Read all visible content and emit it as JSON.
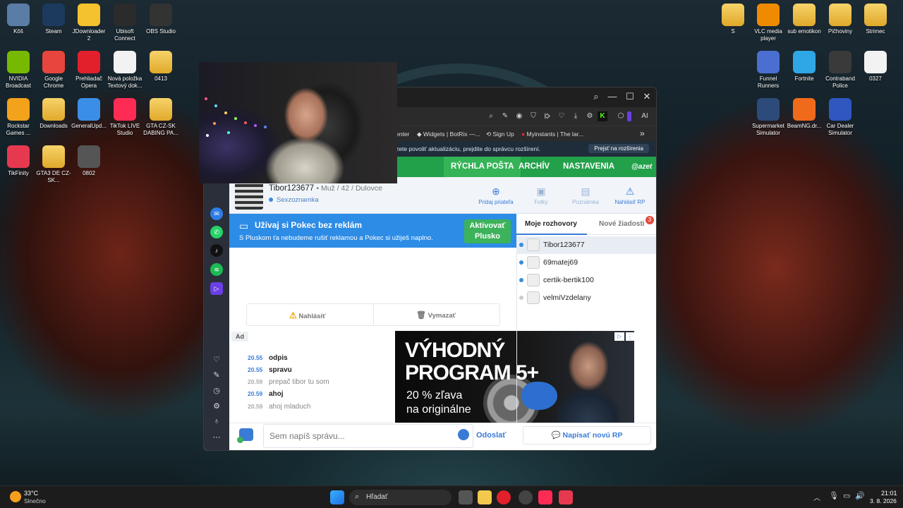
{
  "desktop": {
    "left_icons": [
      {
        "label": "Kôš",
        "icon": "recycle-bin-icon",
        "color": "#5a7da6"
      },
      {
        "label": "Steam",
        "icon": "steam-icon",
        "color": "#1b3a5e"
      },
      {
        "label": "JDownloader 2",
        "icon": "jdownloader-icon",
        "color": "#f3c22e"
      },
      {
        "label": "Ubisoft Connect",
        "icon": "ubisoft-icon",
        "color": "#2b2b2b"
      },
      {
        "label": "OBS Studio",
        "icon": "obs-icon",
        "color": "#333333"
      },
      {
        "label": "NVIDIA Broadcast",
        "icon": "nvidia-icon",
        "color": "#76b900"
      },
      {
        "label": "Google Chrome",
        "icon": "chrome-icon",
        "color": "#e8453c"
      },
      {
        "label": "Prehliadač Opera",
        "icon": "opera-icon",
        "color": "#e2202c"
      },
      {
        "label": "Nová položka Textový dok...",
        "icon": "text-document-icon",
        "color": "#f2f2f2"
      },
      {
        "label": "0413",
        "icon": "folder-icon",
        "color": "#f2c94c"
      },
      {
        "label": "Rockstar Games ...",
        "icon": "rockstar-icon",
        "color": "#f3a21c"
      },
      {
        "label": "Downloads",
        "icon": "folder-icon",
        "color": "#f2c94c"
      },
      {
        "label": "GeneralUpd...",
        "icon": "shield-icon",
        "color": "#3a8ee6"
      },
      {
        "label": "TikTok LIVE Studio",
        "icon": "tiktok-icon",
        "color": "#fe2c55"
      },
      {
        "label": "GTA CZ-SK DABING PA...",
        "icon": "folder-icon",
        "color": "#f2c94c"
      },
      {
        "label": "TikFinity",
        "icon": "tikfinity-icon",
        "color": "#e63950"
      },
      {
        "label": "GTA3 DE CZ-SK...",
        "icon": "folder-icon",
        "color": "#f2c94c"
      },
      {
        "label": "0802",
        "icon": "video-file-icon",
        "color": "#555555"
      }
    ],
    "right_icons": [
      {
        "label": "S",
        "icon": "folder-icon",
        "color": "#f2c94c"
      },
      {
        "label": "VLC media player",
        "icon": "vlc-icon",
        "color": "#f08a00"
      },
      {
        "label": "sub emotikon",
        "icon": "folder-icon",
        "color": "#f2c94c"
      },
      {
        "label": "Pičhoviny",
        "icon": "folder-icon",
        "color": "#f2c94c"
      },
      {
        "label": "Strimec",
        "icon": "folder-icon",
        "color": "#f2c94c"
      },
      {
        "label": "Funnel Runners",
        "icon": "funnel-runners-icon",
        "color": "#4a6fd1"
      },
      {
        "label": "Fortnite",
        "icon": "fortnite-icon",
        "color": "#2fa7e6"
      },
      {
        "label": "Contraband Police",
        "icon": "contraband-police-icon",
        "color": "#3a3a3a"
      },
      {
        "label": "0327",
        "icon": "video-file-icon",
        "color": "#f2f2f2"
      },
      {
        "label": "Supermarket Simulator",
        "icon": "supermarket-icon",
        "color": "#2d4b7a"
      },
      {
        "label": "BeamNG.dr...",
        "icon": "beamng-icon",
        "color": "#f06a1c"
      },
      {
        "label": "Car Dealer Simulator",
        "icon": "car-dealer-icon",
        "color": "#3056c0"
      }
    ]
  },
  "browser": {
    "bookmarks": [
      "enter",
      "Widgets | BotRix —...",
      "Sign Up",
      "Myinstants | The lar..."
    ],
    "more_bookmarks": "»",
    "ai_label": "AI",
    "infobar_text": "zete povoliť aktualizáciu, prejdite do správcu rozšírení.",
    "infobar_button": "Prejsť na rozšírenia"
  },
  "pokec": {
    "nav": [
      "RÝCHLA POŠTA",
      "ARCHÍV",
      "NASTAVENIA"
    ],
    "brand": "azet",
    "profile": {
      "name": "Tibor123677",
      "meta": "• Muž / 42 / Dulovce",
      "status": "Sexzoznamka"
    },
    "profile_actions": [
      "Pridaj priateľa",
      "Fotky",
      "Poznámka",
      "Nahlásiť RP"
    ],
    "promo": {
      "title": "Užívaj si Pokec bez reklám",
      "subtitle": "S Pluskom ťa nebudeme rušiť reklamou a Pokec si užiješ naplno.",
      "button_line1": "Aktivovať",
      "button_line2": "Plusko"
    },
    "report_label": "Nahlásiť",
    "delete_label": "Vymazať",
    "ad_label": "Ad",
    "messages": [
      {
        "time": "20.55",
        "text": "odpis",
        "mine": false
      },
      {
        "time": "20.55",
        "text": "spravu",
        "mine": false
      },
      {
        "time": "20.59",
        "text": "prepač tibor tu som",
        "mine": true
      },
      {
        "time": "20.59",
        "text": "ahoj",
        "mine": false
      },
      {
        "time": "20.59",
        "text": "ahoj mladuch",
        "mine": true
      }
    ],
    "ad": {
      "headline1": "VÝHODNÝ",
      "headline2": "PROGRAM 5+",
      "line1": "20 % zľava",
      "line2": "na originálne"
    },
    "chat_tabs": {
      "mine": "Moje rozhovory",
      "new": "Nové žiadosti",
      "new_count": "3"
    },
    "contacts": [
      "Tibor123677",
      "69matej69",
      "certik-bertik100",
      "velmiVzdelany"
    ],
    "compose": {
      "placeholder": "Sem napíš správu...",
      "send": "Odoslať",
      "new_rp": "Napísať novú RP"
    }
  },
  "taskbar": {
    "weather_temp": "33°C",
    "weather_desc": "Slnečno",
    "search_placeholder": "Hľadať",
    "time": "21:01",
    "date": "3. 8. 2026"
  }
}
